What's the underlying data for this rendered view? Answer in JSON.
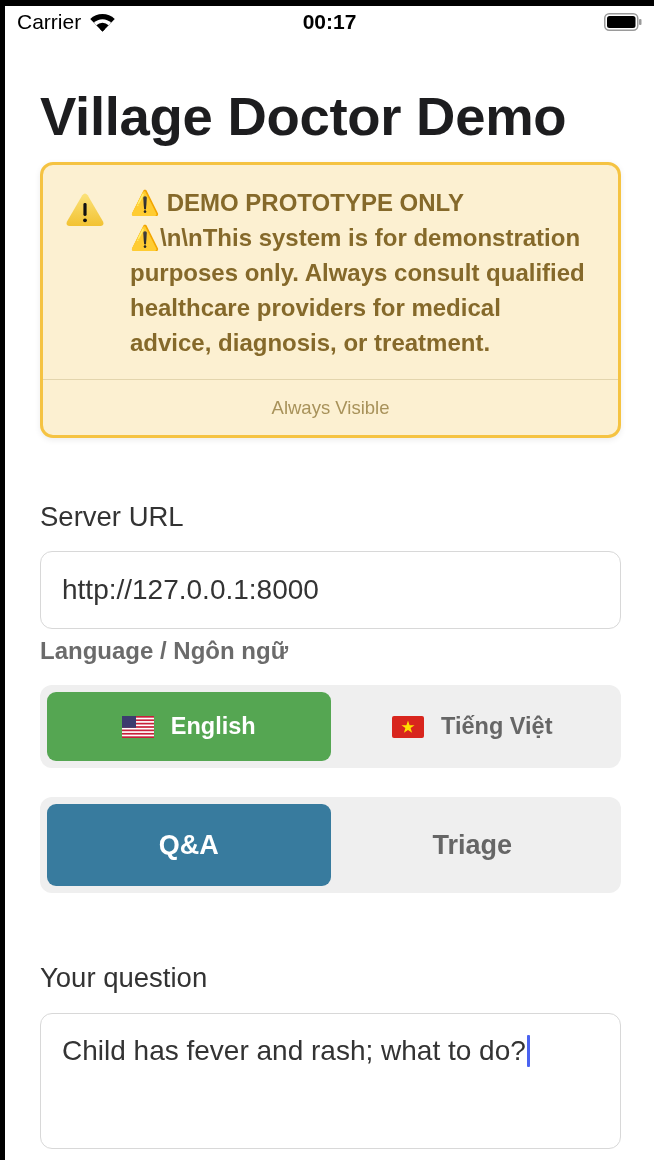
{
  "status_bar": {
    "carrier": "Carrier",
    "time": "00:17"
  },
  "title": "Village Doctor Demo",
  "disclaimer": {
    "message": "⚠️ DEMO PROTOTYPE ONLY ⚠️\\n\\nThis system is for demonstration purposes only. Always consult qualified healthcare providers for medical advice, diagnosis, or treatment.",
    "footer": "Always Visible"
  },
  "server_url": {
    "label": "Server URL",
    "value": "http://127.0.0.1:8000"
  },
  "language": {
    "label": "Language / Ngôn ngữ",
    "options": [
      {
        "kind": "us",
        "label": "English",
        "selected": true
      },
      {
        "kind": "vn",
        "label": "Tiếng Việt",
        "selected": false
      }
    ]
  },
  "modes": [
    {
      "label": "Q&A",
      "selected": true
    },
    {
      "label": "Triage",
      "selected": false
    }
  ],
  "question": {
    "label": "Your question",
    "value": "Child has fever and rash; what to do?",
    "focused": true
  }
}
